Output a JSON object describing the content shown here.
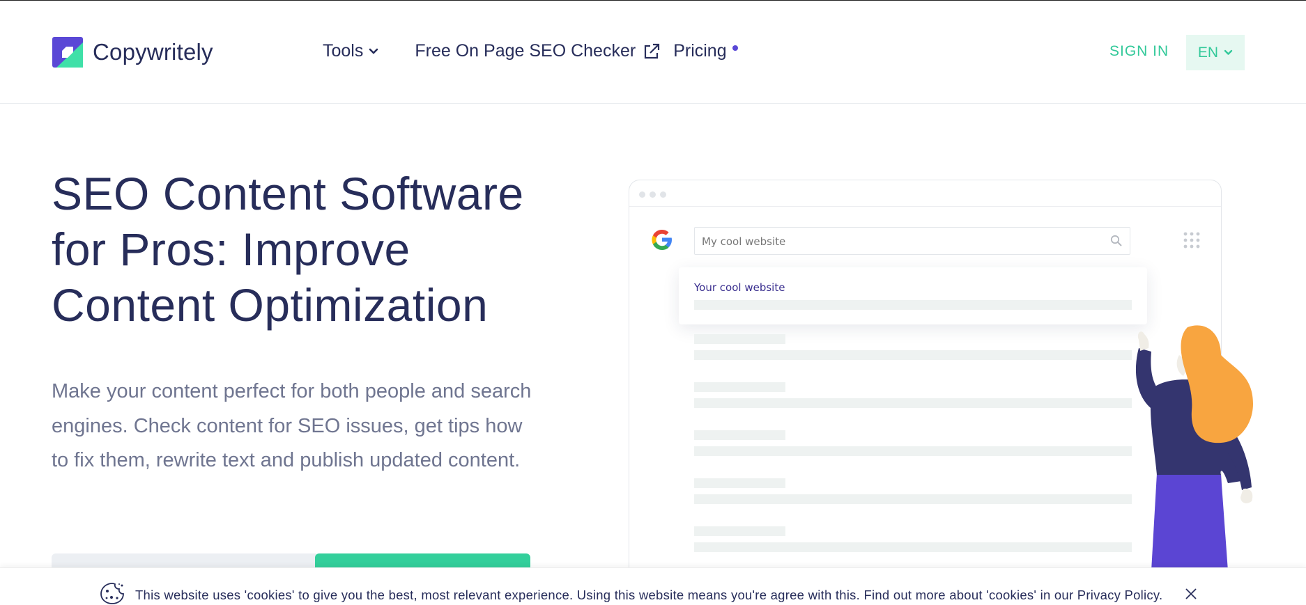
{
  "brand": {
    "name": "Copywritely",
    "colors": {
      "primary": "#5a48d6",
      "accent": "#33cf9b",
      "text": "#272d5a"
    }
  },
  "nav": {
    "tools_label": "Tools",
    "seo_checker_label": "Free On Page SEO Checker",
    "pricing_label": "Pricing",
    "signin_label": "SIGN IN",
    "language": "EN"
  },
  "hero": {
    "title": "SEO Content Software for Pros: Improve Content Optimization",
    "description": "Make your content perfect for both people and search engines. Check content for SEO issues, get tips how to fix them, rewrite text and publish updated content."
  },
  "mockup": {
    "search_placeholder": "My cool website",
    "result_title": "Your cool website"
  },
  "cookie": {
    "text": "This website uses 'cookies' to give you the best, most relevant experience. Using this website means you're agree with this. Find out more about 'cookies' in our Privacy Policy."
  },
  "icons": {
    "logo": "copywritely-logo-icon",
    "tools_dropdown": "chevron-down-icon",
    "external": "external-link-icon",
    "language_dropdown": "chevron-down-icon",
    "search": "search-icon",
    "apps": "grid-icon",
    "cookie": "cookie-icon",
    "close": "close-icon"
  }
}
